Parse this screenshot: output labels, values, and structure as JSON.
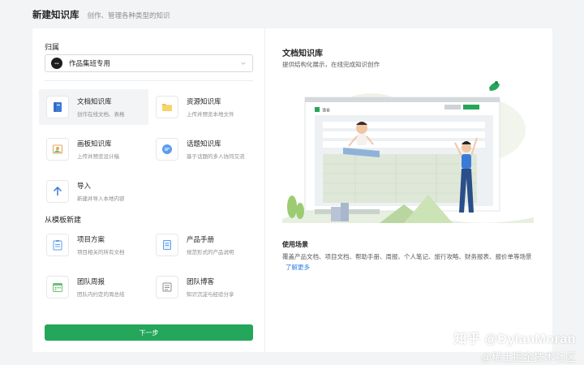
{
  "header": {
    "title": "新建知识库",
    "subtitle": "创作、管理各种类型的知识"
  },
  "left": {
    "owner_label": "归属",
    "owner": {
      "name": "作品集班专用",
      "avatar_icon": "dark-circle-avatar"
    },
    "options": [
      {
        "title": "文档知识库",
        "desc": "创作在线文档、表格",
        "icon": "book-icon",
        "color": "#3b7bd8",
        "selected": true
      },
      {
        "title": "资源知识库",
        "desc": "上传并预览本地文件",
        "icon": "folder-icon",
        "color": "#f4c542",
        "selected": false
      },
      {
        "title": "画板知识库",
        "desc": "上传并预览设计稿",
        "icon": "picture-icon",
        "color": "#e8a05a",
        "selected": false
      },
      {
        "title": "话题知识库",
        "desc": "基于话题的多人协同交流",
        "icon": "chat-bubble-icon",
        "color": "#5b9ef0",
        "selected": false
      },
      {
        "title": "导入",
        "desc": "新建并导入本地内容",
        "icon": "arrow-up-icon",
        "color": "#3b7bd8",
        "selected": false
      }
    ],
    "template_label": "从模板新建",
    "templates": [
      {
        "title": "项目方案",
        "desc": "项目相关的所有文档",
        "icon": "clipboard-icon",
        "color": "#5b9ef0"
      },
      {
        "title": "产品手册",
        "desc": "规范形式的产品说明",
        "icon": "manual-icon",
        "color": "#5b9ef0"
      },
      {
        "title": "团队周报",
        "desc": "团队内约定的周总结",
        "icon": "calendar-icon",
        "color": "#6ec073"
      },
      {
        "title": "团队博客",
        "desc": "知识沉淀与经验分享",
        "icon": "blog-icon",
        "color": "#8a8f8d"
      }
    ],
    "next_button": "下一步"
  },
  "right": {
    "title": "文档知识库",
    "subtitle": "提供结构化展示，在线完成知识创作",
    "usage_title": "使用场景",
    "usage_desc": "覆盖产品文档、项目文档、帮助手册、周报、个人笔记、旅行攻略、财务报表、报价单等场景",
    "learn_more": "了解更多",
    "illustration_logo_text": "语雀",
    "accent": "#24a65b"
  },
  "watermark": {
    "line1": "知乎 @DylanMoran",
    "line2": "@稀土掘金技术社区"
  }
}
